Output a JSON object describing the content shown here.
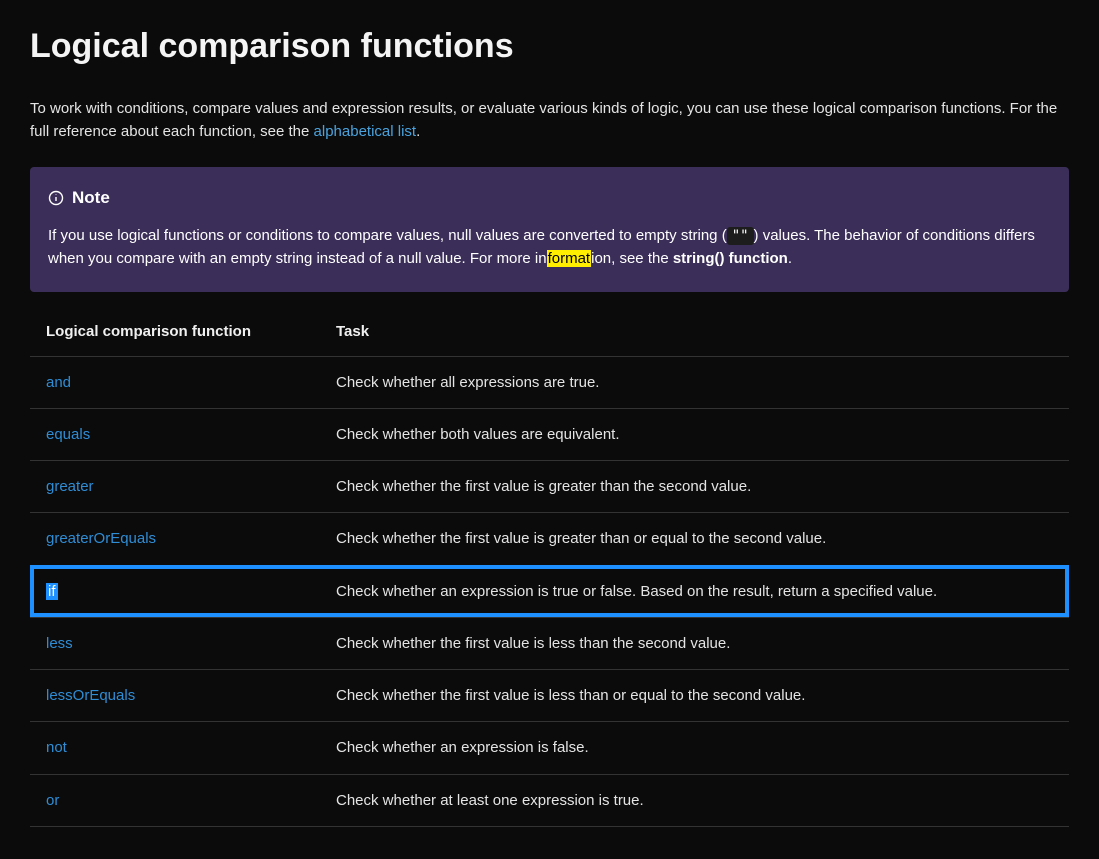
{
  "page": {
    "title": "Logical comparison functions",
    "intro_before_link": "To work with conditions, compare values and expression results, or evaluate various kinds of logic, you can use these logical comparison functions. For the full reference about each function, see the ",
    "intro_link": "alphabetical list",
    "intro_after_link": "."
  },
  "note": {
    "label": "Note",
    "text_part1": "If you use logical functions or conditions to compare values, null values are converted to empty string (",
    "code_empty": "\"\"",
    "text_part2": ") values. The behavior of conditions differs when you compare with an empty string instead of a null value. For more in",
    "highlighted": "format",
    "text_part3": "ion, see the ",
    "bold_link": "string() function",
    "text_part4": "."
  },
  "table": {
    "headers": {
      "col1": "Logical comparison function",
      "col2": "Task"
    },
    "rows": [
      {
        "fn": "and",
        "task": "Check whether all expressions are true.",
        "highlight": false
      },
      {
        "fn": "equals",
        "task": "Check whether both values are equivalent.",
        "highlight": false
      },
      {
        "fn": "greater",
        "task": "Check whether the first value is greater than the second value.",
        "highlight": false
      },
      {
        "fn": "greaterOrEquals",
        "task": "Check whether the first value is greater than or equal to the second value.",
        "highlight": false
      },
      {
        "fn": "if",
        "task": "Check whether an expression is true or false. Based on the result, return a specified value.",
        "highlight": true
      },
      {
        "fn": "less",
        "task": "Check whether the first value is less than the second value.",
        "highlight": false
      },
      {
        "fn": "lessOrEquals",
        "task": "Check whether the first value is less than or equal to the second value.",
        "highlight": false
      },
      {
        "fn": "not",
        "task": "Check whether an expression is false.",
        "highlight": false
      },
      {
        "fn": "or",
        "task": "Check whether at least one expression is true.",
        "highlight": false
      }
    ]
  }
}
